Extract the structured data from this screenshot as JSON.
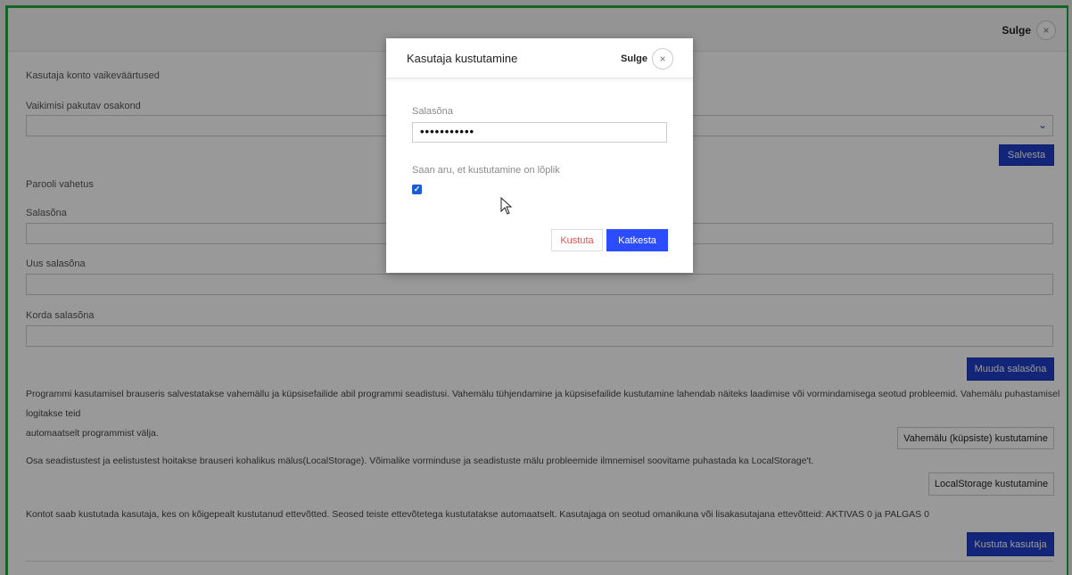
{
  "topbar": {
    "close_label": "Sulge",
    "close_icon": "×"
  },
  "account": {
    "section_title": "Kasutaja konto vaikeväärtused",
    "department_label": "Vaikimisi pakutav osakond",
    "department_value": "",
    "caret": "⌄",
    "save_button": "Salvesta"
  },
  "password_change": {
    "section_title": "Parooli vahetus",
    "password_label": "Salasõna",
    "new_password_label": "Uus salasõna",
    "repeat_password_label": "Korda salasõna",
    "submit_button": "Muuda salasõna"
  },
  "cache": {
    "description_line1": "Programmi kasutamisel brauseris salvestatakse vahemällu ja küpsisefailide abil programmi seadistusi. Vahemälu tühjendamine ja küpsisefailide kustutamine lahendab näiteks laadimise või vormindamisega seotud probleemid. Vahemälu puhastamisel logitakse teid",
    "description_line2": "automaatselt programmist välja.",
    "clear_button": "Vahemälu (küpsiste) kustutamine"
  },
  "local_storage": {
    "description": "Osa seadistustest ja eelistustest hoitakse brauseri kohalikus mälus(LocalStorage). Võimalike vorminduse ja seadistuste mälu probleemide ilmnemisel soovitame puhastada ka LocalStorage't.",
    "clear_button": "LocalStorage kustutamine"
  },
  "delete_account": {
    "description": "Kontot saab kustutada kasutaja, kes on kõigepealt kustutanud ettevõtted. Seosed teiste ettevõtetega kustutatakse automaatselt. Kasutajaga on seotud omanikuna või lisakasutajana ettevõtteid: AKTIVAS 0 ja PALGAS 0",
    "delete_button": "Kustuta kasutaja"
  },
  "modal": {
    "title": "Kasutaja kustutamine",
    "close_label": "Sulge",
    "close_icon": "×",
    "password_label": "Salasõna",
    "password_value": "•••••••••••",
    "confirm_label": "Saan aru, et kustutamine on lõplik",
    "confirm_checked": true,
    "checkmark": "✓",
    "delete_button": "Kustuta",
    "cancel_button": "Katkesta"
  },
  "colors": {
    "primary": "#1e3fc9",
    "danger_text": "#e05555",
    "frame_border": "#1fa83a"
  }
}
